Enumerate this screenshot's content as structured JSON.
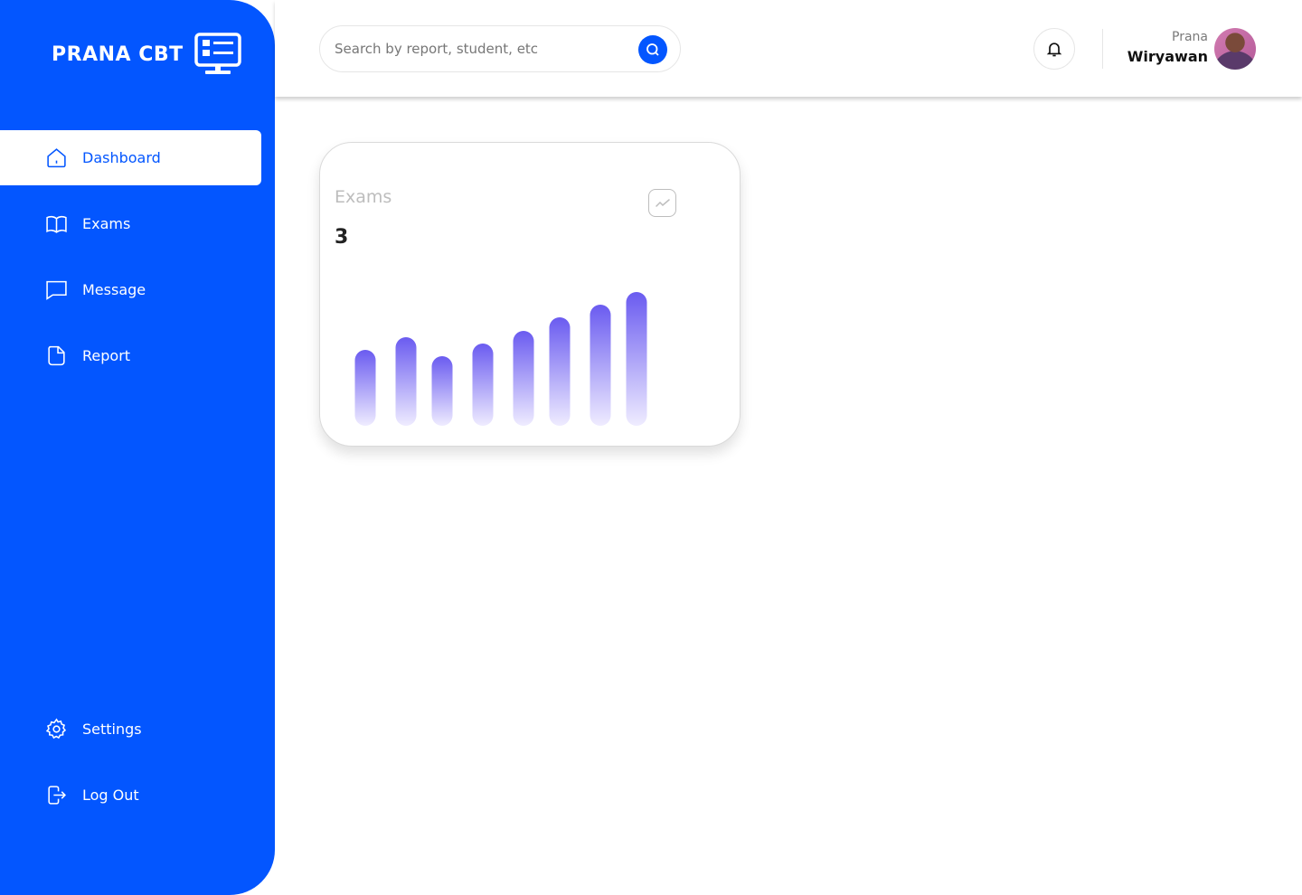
{
  "brand": {
    "name": "PRANA CBT"
  },
  "sidebar": {
    "items": [
      {
        "label": "Dashboard",
        "icon": "home-icon",
        "active": true
      },
      {
        "label": "Exams",
        "icon": "book-icon",
        "active": false
      },
      {
        "label": "Message",
        "icon": "message-icon",
        "active": false
      },
      {
        "label": "Report",
        "icon": "report-icon",
        "active": false
      }
    ],
    "bottom": [
      {
        "label": "Settings",
        "icon": "gear-icon"
      },
      {
        "label": "Log Out",
        "icon": "logout-icon"
      }
    ]
  },
  "header": {
    "search": {
      "placeholder": "Search by report, student, etc"
    },
    "user": {
      "first_name": "Prana",
      "last_name": "Wiryawan"
    }
  },
  "card": {
    "title": "Exams",
    "value": "3",
    "icon": "trend-icon"
  },
  "chart_data": {
    "type": "bar",
    "values": [
      84,
      98,
      77,
      91,
      105,
      120,
      134,
      148
    ],
    "bar_gradient": [
      "#6A5BF0",
      "#EFECFF"
    ]
  },
  "colors": {
    "primary": "#0356FF",
    "bar_top": "#6A5BF0",
    "bar_bottom": "#EFECFF"
  }
}
